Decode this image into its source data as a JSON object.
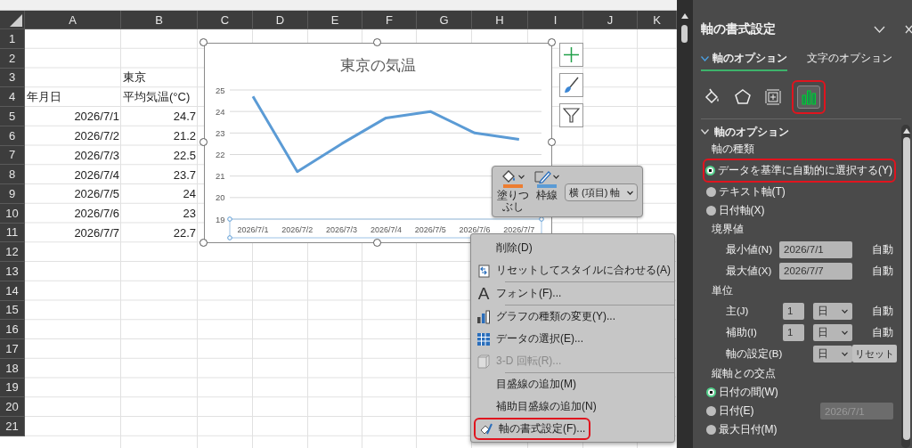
{
  "sheet": {
    "columns": [
      "A",
      "B",
      "C",
      "D",
      "E",
      "F",
      "G",
      "H",
      "I",
      "J",
      "K"
    ],
    "rows": [
      {
        "number": "1"
      },
      {
        "number": "2"
      },
      {
        "number": "3",
        "b": {
          "text": "東京",
          "kind": "text"
        }
      },
      {
        "number": "4",
        "a": {
          "text": "年月日",
          "kind": "text"
        },
        "b": {
          "text": "平均気温(°C)",
          "kind": "text"
        }
      },
      {
        "number": "5",
        "a": {
          "text": "2026/7/1",
          "kind": "number"
        },
        "b": {
          "text": "24.7",
          "kind": "number"
        }
      },
      {
        "number": "6",
        "a": {
          "text": "2026/7/2",
          "kind": "number"
        },
        "b": {
          "text": "21.2",
          "kind": "number"
        }
      },
      {
        "number": "7",
        "a": {
          "text": "2026/7/3",
          "kind": "number"
        },
        "b": {
          "text": "22.5",
          "kind": "number"
        }
      },
      {
        "number": "8",
        "a": {
          "text": "2026/7/4",
          "kind": "number"
        },
        "b": {
          "text": "23.7",
          "kind": "number"
        }
      },
      {
        "number": "9",
        "a": {
          "text": "2026/7/5",
          "kind": "number"
        },
        "b": {
          "text": "24",
          "kind": "number"
        }
      },
      {
        "number": "10",
        "a": {
          "text": "2026/7/6",
          "kind": "number"
        },
        "b": {
          "text": "23",
          "kind": "number"
        }
      },
      {
        "number": "11",
        "a": {
          "text": "2026/7/7",
          "kind": "number"
        },
        "b": {
          "text": "22.7",
          "kind": "number"
        }
      },
      {
        "number": "12"
      },
      {
        "number": "13"
      },
      {
        "number": "14"
      },
      {
        "number": "15"
      },
      {
        "number": "16"
      },
      {
        "number": "17"
      },
      {
        "number": "18"
      },
      {
        "number": "19"
      },
      {
        "number": "20"
      },
      {
        "number": "21"
      }
    ]
  },
  "chart": {
    "chart_data": {
      "type": "line",
      "title": "東京の気温",
      "categories": [
        "2026/7/1",
        "2026/7/2",
        "2026/7/3",
        "2026/7/4",
        "2026/7/5",
        "2026/7/6",
        "2026/7/7"
      ],
      "values": [
        24.7,
        21.2,
        22.5,
        23.7,
        24,
        23,
        22.7
      ],
      "ylim": [
        19,
        25
      ],
      "yticks": [
        19,
        20,
        21,
        22,
        23,
        24,
        25
      ],
      "grid": true
    }
  },
  "mini_toolbar": {
    "fill_label": "塗りつぶし",
    "outline_label": "枠線",
    "element_select": "横 (項目) 軸"
  },
  "context_menu": {
    "groups": [
      [
        {
          "kind": "delete",
          "label": "削除(D)",
          "disabled": false,
          "highlighted": false
        },
        {
          "kind": "reset",
          "label": "リセットしてスタイルに合わせる(A)",
          "disabled": false,
          "highlighted": false
        }
      ],
      [
        {
          "kind": "font",
          "glyph": "A",
          "label": "フォント(F)...",
          "disabled": false,
          "highlighted": false
        }
      ],
      [
        {
          "kind": "chart_type",
          "label": "グラフの種類の変更(Y)...",
          "disabled": false,
          "highlighted": false
        },
        {
          "kind": "data",
          "label": "データの選択(E)...",
          "disabled": false,
          "highlighted": false
        },
        {
          "kind": "rotation",
          "label": "3-D 回転(R)...",
          "disabled": true,
          "highlighted": false
        }
      ],
      [
        {
          "kind": "gridlines",
          "label": "目盛線の追加(M)",
          "disabled": false,
          "highlighted": false
        },
        {
          "kind": "minor_gridlines",
          "label": "補助目盛線の追加(N)",
          "disabled": false,
          "highlighted": false
        },
        {
          "kind": "format_axis",
          "label": "軸の書式設定(F)...",
          "disabled": false,
          "highlighted": true
        }
      ]
    ]
  },
  "format_panel": {
    "title": "軸の書式設定",
    "tabs": [
      {
        "label": "軸のオプション",
        "selected": true
      },
      {
        "label": "文字のオプション",
        "selected": false
      }
    ],
    "icon_tabs": [
      {
        "kind": "fill",
        "selected": false,
        "highlighted": false
      },
      {
        "kind": "effects",
        "selected": false,
        "highlighted": false
      },
      {
        "kind": "size",
        "selected": false,
        "highlighted": false
      },
      {
        "kind": "axis",
        "selected": true,
        "highlighted": true
      }
    ],
    "section": {
      "title": "軸のオプション",
      "expanded": true
    },
    "items": [
      {
        "kind": "heading",
        "label": "軸の種類"
      },
      {
        "kind": "radio",
        "label": "データを基準に自動的に選択する(Y)",
        "selected": true,
        "highlighted": true
      },
      {
        "kind": "radio",
        "label": "テキスト軸(T)",
        "selected": false,
        "highlighted": false
      },
      {
        "kind": "radio",
        "label": "日付軸(X)",
        "selected": false,
        "highlighted": false
      },
      {
        "kind": "heading",
        "label": "境界値"
      },
      {
        "kind": "bound",
        "label": "最小値(N)",
        "value": "2026/7/1",
        "auto": "自動"
      },
      {
        "kind": "bound",
        "label": "最大値(X)",
        "value": "2026/7/7",
        "auto": "自動"
      },
      {
        "kind": "heading",
        "label": "単位"
      },
      {
        "kind": "unit",
        "label": "主(J)",
        "value": "1",
        "unit": "日",
        "auto": "自動"
      },
      {
        "kind": "unit",
        "label": "補助(I)",
        "value": "1",
        "unit": "日",
        "auto": "自動"
      },
      {
        "kind": "base",
        "label": "軸の設定(B)",
        "unit": "日",
        "button": "リセット"
      },
      {
        "kind": "heading",
        "label": "縦軸との交点"
      },
      {
        "kind": "radio",
        "label": "日付の間(W)",
        "selected": true,
        "highlighted": false
      },
      {
        "kind": "radio",
        "label": "日付(E)",
        "selected": false,
        "highlighted": false,
        "field": {
          "value": "2026/7/1",
          "disabled": true
        }
      },
      {
        "kind": "radio",
        "label": "最大日付(M)",
        "selected": false,
        "highlighted": false
      }
    ]
  }
}
